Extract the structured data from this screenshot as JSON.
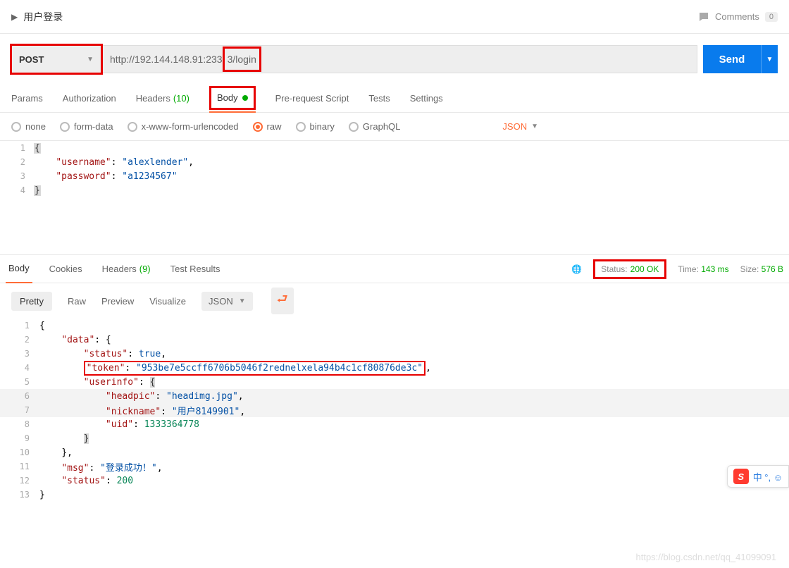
{
  "header": {
    "title": "用户登录",
    "comments_label": "Comments",
    "comments_count": "0"
  },
  "request": {
    "method": "POST",
    "url_prefix": "http://192.144.148.91:233",
    "url_suffix": "3/login",
    "send_label": "Send"
  },
  "req_tabs": {
    "params": "Params",
    "auth": "Authorization",
    "headers": "Headers",
    "headers_count": "(10)",
    "body": "Body",
    "prerequest": "Pre-request Script",
    "tests": "Tests",
    "settings": "Settings"
  },
  "body_types": {
    "none": "none",
    "formdata": "form-data",
    "xwww": "x-www-form-urlencoded",
    "raw": "raw",
    "binary": "binary",
    "graphql": "GraphQL",
    "json": "JSON"
  },
  "req_body": {
    "lines": [
      "1",
      "2",
      "3",
      "4"
    ],
    "l1": "{",
    "l2_key": "\"username\"",
    "l2_val": "\"alexlender\"",
    "l3_key": "\"password\"",
    "l3_val": "\"a1234567\"",
    "l4": "}"
  },
  "resp_tabs": {
    "body": "Body",
    "cookies": "Cookies",
    "headers": "Headers",
    "headers_count": "(9)",
    "tests": "Test Results"
  },
  "resp_meta": {
    "status_label": "Status:",
    "status_value": "200 OK",
    "time_label": "Time:",
    "time_value": "143 ms",
    "size_label": "Size:",
    "size_value": "576 B"
  },
  "view": {
    "pretty": "Pretty",
    "raw": "Raw",
    "preview": "Preview",
    "visualize": "Visualize",
    "type": "JSON"
  },
  "resp_body": {
    "lines": [
      "1",
      "2",
      "3",
      "4",
      "5",
      "6",
      "7",
      "8",
      "9",
      "10",
      "11",
      "12",
      "13"
    ],
    "l1": "{",
    "l2_key": "\"data\"",
    "l3_key": "\"status\"",
    "l3_val": "true",
    "l4_key": "\"token\"",
    "l4_val": "\"953be7e5ccff6706b5046f2rednelxela94b4c1cf80876de3c\"",
    "l5_key": "\"userinfo\"",
    "l6_key": "\"headpic\"",
    "l6_val": "\"headimg.jpg\"",
    "l7_key": "\"nickname\"",
    "l7_val": "\"用户8149901\"",
    "l8_key": "\"uid\"",
    "l8_val": "1333364778",
    "l11_key": "\"msg\"",
    "l11_val": "\"登录成功！\"",
    "l12_key": "\"status\"",
    "l12_val": "200"
  },
  "ime": {
    "badge": "S",
    "text": "中 °, ☺"
  },
  "watermark": "https://blog.csdn.net/qq_41099091"
}
